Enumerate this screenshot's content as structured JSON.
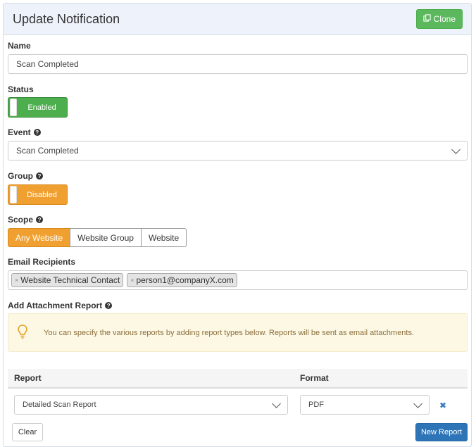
{
  "header": {
    "title": "Update Notification",
    "clone_label": "Clone"
  },
  "name": {
    "label": "Name",
    "value": "Scan Completed"
  },
  "status": {
    "label": "Status",
    "toggle_label": "Enabled",
    "on": true
  },
  "event": {
    "label": "Event",
    "selected": "Scan Completed"
  },
  "group": {
    "label": "Group",
    "toggle_label": "Disabled",
    "on": false
  },
  "scope": {
    "label": "Scope",
    "options": [
      "Any Website",
      "Website Group",
      "Website"
    ],
    "selected": "Any Website"
  },
  "recipients": {
    "label": "Email Recipients",
    "tags": [
      "Website Technical Contact",
      "person1@companyX.com"
    ]
  },
  "attachment": {
    "label": "Add Attachment Report",
    "info": "You can specify the various reports by adding report types below. Reports will be sent as email attachments."
  },
  "report_table": {
    "headers": {
      "report": "Report",
      "format": "Format"
    },
    "rows": [
      {
        "report": "Detailed Scan Report",
        "format": "PDF"
      }
    ]
  },
  "actions": {
    "clear_label": "Clear",
    "new_report_label": "New Report"
  },
  "colors": {
    "success": "#4cae4c",
    "warning": "#f0a030",
    "primary": "#2e75b7"
  }
}
